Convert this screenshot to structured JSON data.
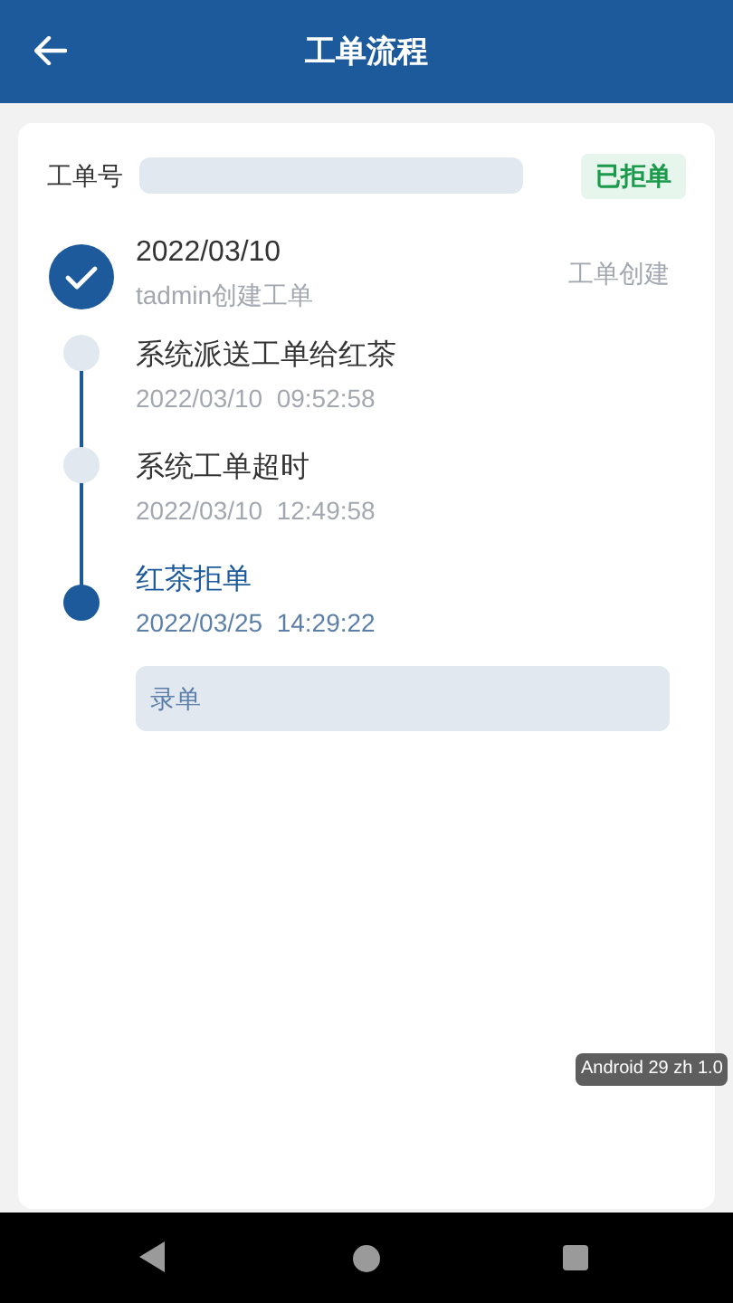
{
  "header": {
    "title": "工单流程"
  },
  "order": {
    "label": "工单号",
    "status": "已拒单"
  },
  "steps": [
    {
      "kind": "done",
      "title": "2022/03/10",
      "subtitle": "tadmin创建工单",
      "tag": "工单创建"
    },
    {
      "kind": "pending",
      "title": "系统派送工单给红茶",
      "subtitle": "2022/03/10  09:52:58"
    },
    {
      "kind": "pending",
      "title": "系统工单超时",
      "subtitle": "2022/03/10  12:49:58"
    },
    {
      "kind": "current",
      "title": "红茶拒单",
      "subtitle": "2022/03/25  14:29:22",
      "note": "录单"
    }
  ],
  "debug_badge": "Android 29 zh 1.0"
}
